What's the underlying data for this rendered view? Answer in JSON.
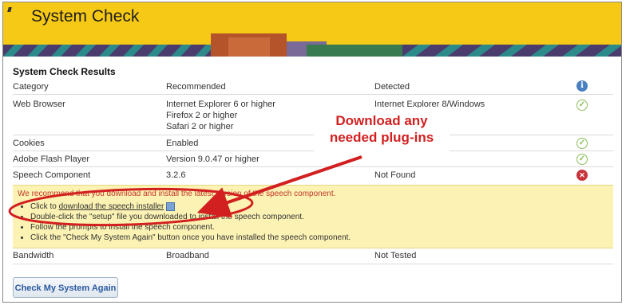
{
  "header": {
    "title": "System Check"
  },
  "results": {
    "title": "System Check Results",
    "columns": {
      "category": "Category",
      "recommended": "Recommended",
      "detected": "Detected"
    },
    "rows": [
      {
        "category": "Web Browser",
        "recommended": [
          "Internet Explorer 6 or higher",
          "Firefox 2 or higher",
          "Safari 2 or higher"
        ],
        "detected": "Internet Explorer 8/Windows",
        "status": "ok"
      },
      {
        "category": "Cookies",
        "recommended": "Enabled",
        "detected": "",
        "status": "ok"
      },
      {
        "category": "Adobe Flash Player",
        "recommended": "Version 9.0.47 or higher",
        "detected": "",
        "status": "ok"
      },
      {
        "category": "Speech Component",
        "recommended": "3.2.6",
        "detected": "Not Found",
        "status": "error"
      },
      {
        "category": "Bandwidth",
        "recommended": "Broadband",
        "detected": "Not Tested",
        "status": ""
      }
    ]
  },
  "notice": {
    "message": "We recommend that you download and install the latest version of the speech component.",
    "bullets": [
      {
        "prefix": "Click to ",
        "link": "download the speech installer"
      },
      {
        "text": "Double-click the \"setup\" file you downloaded to install the speech component."
      },
      {
        "text": "Follow the prompts to install the speech component."
      },
      {
        "text": "Click the \"Check My System Again\" button once you have installed the speech component."
      }
    ]
  },
  "button": {
    "label": "Check My System Again"
  },
  "callout": {
    "line1": "Download any",
    "line2": "needed plug-ins"
  },
  "colors": {
    "header_bg": "#f6c916",
    "callout_red": "#d21f1f",
    "notice_bg": "#fbf2b3",
    "ok_green": "#8bbf5c",
    "error_red": "#c8323a",
    "info_blue": "#4a7fc1"
  }
}
